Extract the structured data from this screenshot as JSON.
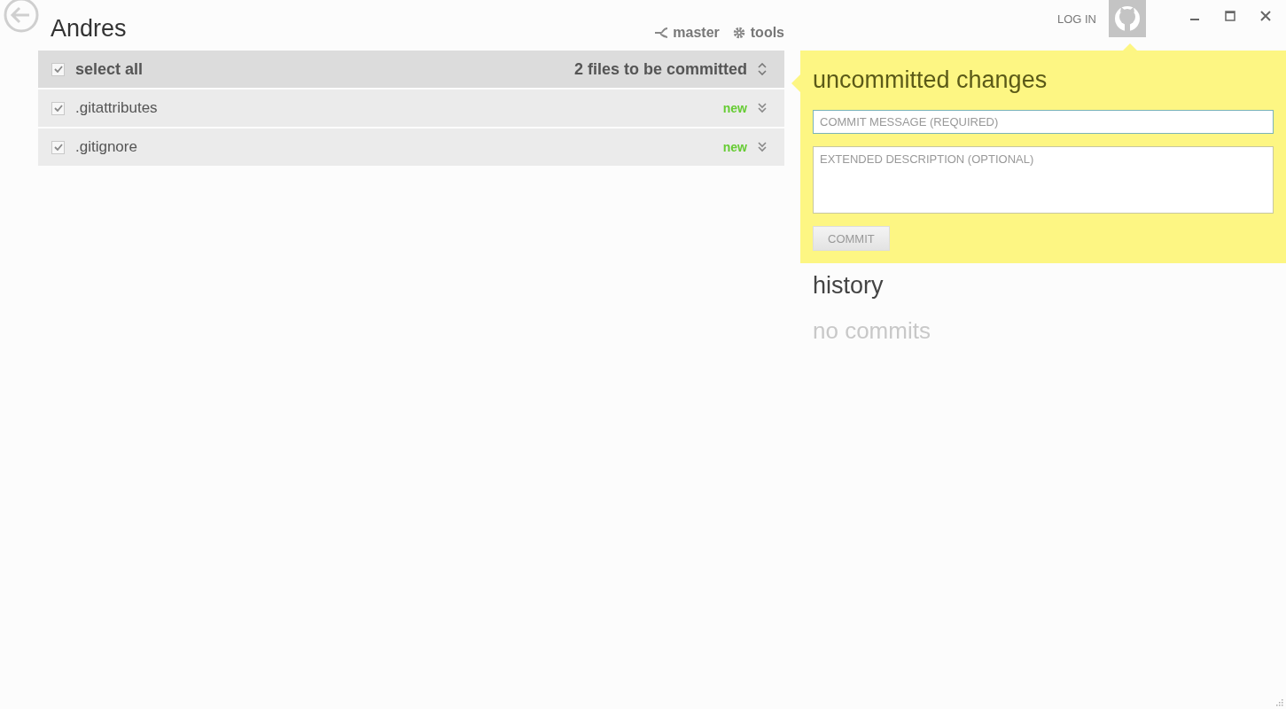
{
  "repository": {
    "name": "Andres"
  },
  "toolbar": [
    {
      "kind": "branch",
      "label": "master"
    },
    {
      "kind": "tools",
      "label": "tools"
    }
  ],
  "account": {
    "login": "LOG IN"
  },
  "file_list": {
    "select_all": {
      "label": "select all",
      "checked": true
    },
    "summary": "2 files to be committed",
    "files": [
      {
        "name": ".gitattributes",
        "status": "new",
        "checked": true
      },
      {
        "name": ".gitignore",
        "status": "new",
        "checked": true
      }
    ]
  },
  "commit_panel": {
    "title": "uncommitted changes",
    "message": {
      "placeholder": "COMMIT MESSAGE (REQUIRED)"
    },
    "description": {
      "placeholder": "EXTENDED DESCRIPTION (OPTIONAL)"
    },
    "button": {
      "label": "COMMIT",
      "disabled": true
    }
  },
  "history": {
    "title": "history",
    "empty_text": "no commits"
  }
}
